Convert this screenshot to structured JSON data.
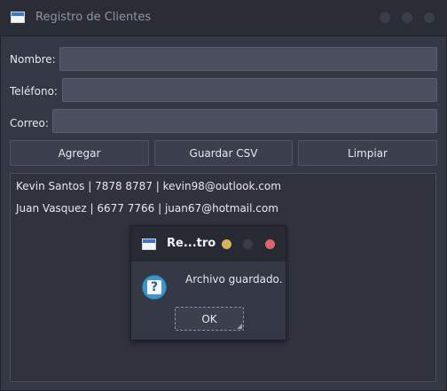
{
  "window": {
    "title": "Registro de Clientes"
  },
  "form": {
    "nombre_label": "Nombre:",
    "nombre_value": "",
    "telefono_label": "Teléfono:",
    "telefono_value": "",
    "correo_label": "Correo:",
    "correo_value": ""
  },
  "buttons": {
    "agregar": "Agregar",
    "guardar_csv": "Guardar CSV",
    "limpiar": "Limpiar"
  },
  "clients": [
    "Kevin Santos | 7878 8787 | kevin98@outlook.com",
    "Juan Vasquez | 6677 7766 | juan67@hotmail.com"
  ],
  "dialog": {
    "title": "Re...tro",
    "message": "Archivo guardado.",
    "ok_label": "OK",
    "icon": "question-icon",
    "control_colors": [
      "#d8b25a",
      "#3a3d47",
      "#e06464"
    ]
  },
  "colors": {
    "window_bg": "#343744",
    "titlebar_bg": "#2a2d36",
    "field_bg": "#4a4e5e",
    "button_bg": "#3c404d",
    "text": "#e6e8ee"
  }
}
